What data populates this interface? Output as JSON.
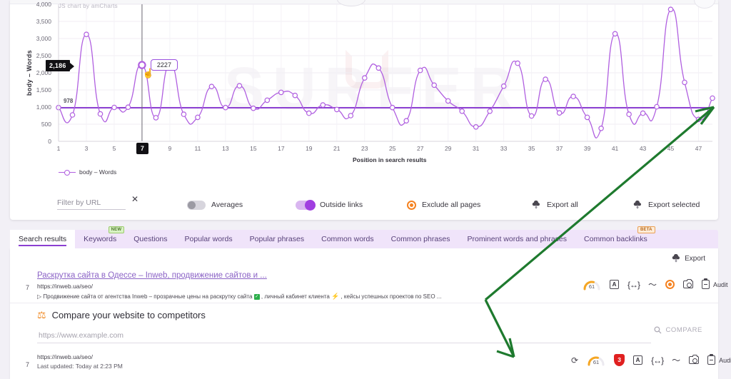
{
  "chart": {
    "credit": "JS chart by amCharts",
    "watermark": "SURFER",
    "y_axis_title": "body – Words",
    "x_axis_title": "Position in search results",
    "y_cursor_value": "2,186",
    "x_cursor_value": "7",
    "average_label": "978",
    "tooltip_value": "2227",
    "legend": [
      {
        "label": "body – Words",
        "color": "#b05fe0"
      }
    ],
    "accent": "#a03ee0"
  },
  "chart_data": {
    "type": "line",
    "title": "",
    "xlabel": "Position in search results",
    "ylabel": "body – Words",
    "ylim": [
      0,
      4000
    ],
    "xlim": [
      1,
      48
    ],
    "grid": true,
    "legend_position": "bottom-left",
    "ytick_labels": [
      "4,000",
      "3,500",
      "3,000",
      "2,500",
      "2,000",
      "1,500",
      "1,000",
      "500",
      "0"
    ],
    "ytick_values": [
      4000,
      3500,
      3000,
      2500,
      2000,
      1500,
      1000,
      500,
      0
    ],
    "xtick_labels": [
      "1",
      "3",
      "5",
      "7",
      "9",
      "11",
      "13",
      "15",
      "17",
      "19",
      "21",
      "23",
      "25",
      "27",
      "29",
      "31",
      "33",
      "35",
      "37",
      "39",
      "41",
      "43",
      "45",
      "47"
    ],
    "average_line": 978,
    "series": [
      {
        "name": "body – Words",
        "color": "#b05fe0",
        "x": [
          1,
          2,
          3,
          4,
          5,
          6,
          7,
          8,
          9,
          10,
          11,
          12,
          13,
          14,
          15,
          16,
          17,
          18,
          19,
          20,
          21,
          22,
          23,
          24,
          25,
          26,
          27,
          28,
          29,
          30,
          31,
          32,
          33,
          34,
          35,
          36,
          37,
          38,
          39,
          40,
          41,
          42,
          43,
          44,
          45,
          46,
          47,
          48
        ],
        "values": [
          985,
          770,
          3120,
          800,
          990,
          995,
          2227,
          690,
          2245,
          790,
          700,
          1600,
          985,
          1620,
          965,
          1200,
          1430,
          1340,
          820,
          1060,
          930,
          750,
          1850,
          2140,
          985,
          600,
          2070,
          1640,
          1180,
          880,
          420,
          880,
          1610,
          2280,
          740,
          1810,
          830,
          1310,
          700,
          380,
          3140,
          790,
          820,
          1010,
          3850,
          1720,
          640,
          1260
        ]
      }
    ]
  },
  "controls": {
    "filter_placeholder": "Filter by URL",
    "filter_value": "",
    "averages_label": "Averages",
    "averages_on": false,
    "outside_links_label": "Outside links",
    "outside_links_on": true,
    "exclude_label": "Exclude all pages",
    "export_all_label": "Export all",
    "export_selected_label": "Export selected"
  },
  "tabs": [
    {
      "label": "Search results",
      "active": true,
      "badge": ""
    },
    {
      "label": "Keywords",
      "active": false,
      "badge": "NEW"
    },
    {
      "label": "Questions",
      "active": false,
      "badge": ""
    },
    {
      "label": "Popular words",
      "active": false,
      "badge": ""
    },
    {
      "label": "Popular phrases",
      "active": false,
      "badge": ""
    },
    {
      "label": "Common words",
      "active": false,
      "badge": ""
    },
    {
      "label": "Common phrases",
      "active": false,
      "badge": ""
    },
    {
      "label": "Prominent words and phrases",
      "active": false,
      "badge": ""
    },
    {
      "label": "Common backlinks",
      "active": false,
      "badge": "BETA"
    }
  ],
  "results_panel": {
    "export_label": "Export",
    "audit_label": "Audit",
    "result": {
      "rank": "7",
      "title": "Раскрутка сайта в Одессе – Inweb, продвижение сайтов и ...",
      "url": "https://inweb.ua/seo/",
      "description_before": "▷ Продвижение сайта от агентства Inweb – прозрачные цены на раскрутку сайта",
      "description_mid": ", личный кабинет клиента",
      "description_after": ", кейсы успешных проектов по SEO ...",
      "score": "61"
    },
    "compare": {
      "title": "Compare your website to competitors",
      "input_placeholder": "https://www.example.com",
      "input_value": "",
      "button_label": "COMPARE"
    },
    "row2": {
      "rank": "7",
      "url": "https://inweb.ua/seo/",
      "updated": "Last updated: Today at 2:23 PM",
      "score": "61",
      "issues": "3"
    }
  }
}
